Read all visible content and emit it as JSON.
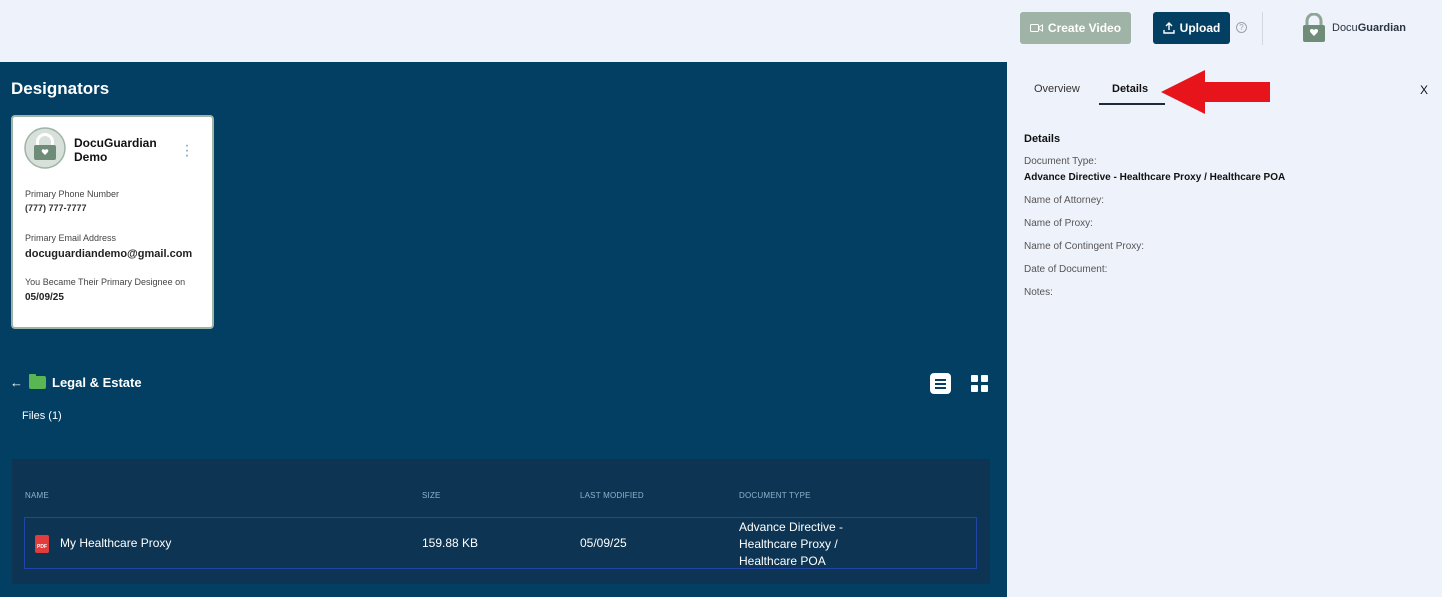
{
  "header": {
    "create_video_label": "Create Video",
    "upload_label": "Upload",
    "help_icon": "?",
    "logo_text_light": "Docu",
    "logo_text_bold": "Guardian"
  },
  "main": {
    "title": "Designators",
    "card": {
      "name": "DocuGuardian Demo",
      "phone_label": "Primary Phone Number",
      "phone_value": "(777) 777-7777",
      "email_label": "Primary Email Address",
      "email_value": "docuguardiandemo@gmail.com",
      "since_label": "You Became Their Primary Designee on",
      "since_value": "05/09/25"
    },
    "folder": {
      "back_icon": "←",
      "name": "Legal & Estate",
      "files_count": "Files (1)"
    },
    "table": {
      "headers": [
        "NAME",
        "SIZE",
        "LAST MODIFIED",
        "DOCUMENT TYPE"
      ],
      "rows": [
        {
          "name": "My Healthcare Proxy",
          "size": "159.88 KB",
          "modified": "05/09/25",
          "doc_type_lines": [
            "Advance Directive -",
            "Healthcare Proxy /",
            "Healthcare POA"
          ],
          "file_icon_text": "PDF"
        }
      ]
    }
  },
  "panel": {
    "tabs": [
      "Overview",
      "Details"
    ],
    "active_tab": "Details",
    "close": "X",
    "section_title": "Details",
    "fields": {
      "doc_type_label": "Document Type:",
      "doc_type_value": "Advance Directive - Healthcare Proxy / Healthcare POA",
      "attorney_label": "Name of Attorney:",
      "proxy_label": "Name of Proxy:",
      "contingent_label": "Name of Contingent Proxy:",
      "date_label": "Date of Document:",
      "notes_label": "Notes:"
    }
  },
  "colors": {
    "navy": "#033e63",
    "sage": "#9fb3a7",
    "panel_bg": "#eef2fb",
    "arrow_red": "#e8141b",
    "folder_green": "#5ab553"
  }
}
